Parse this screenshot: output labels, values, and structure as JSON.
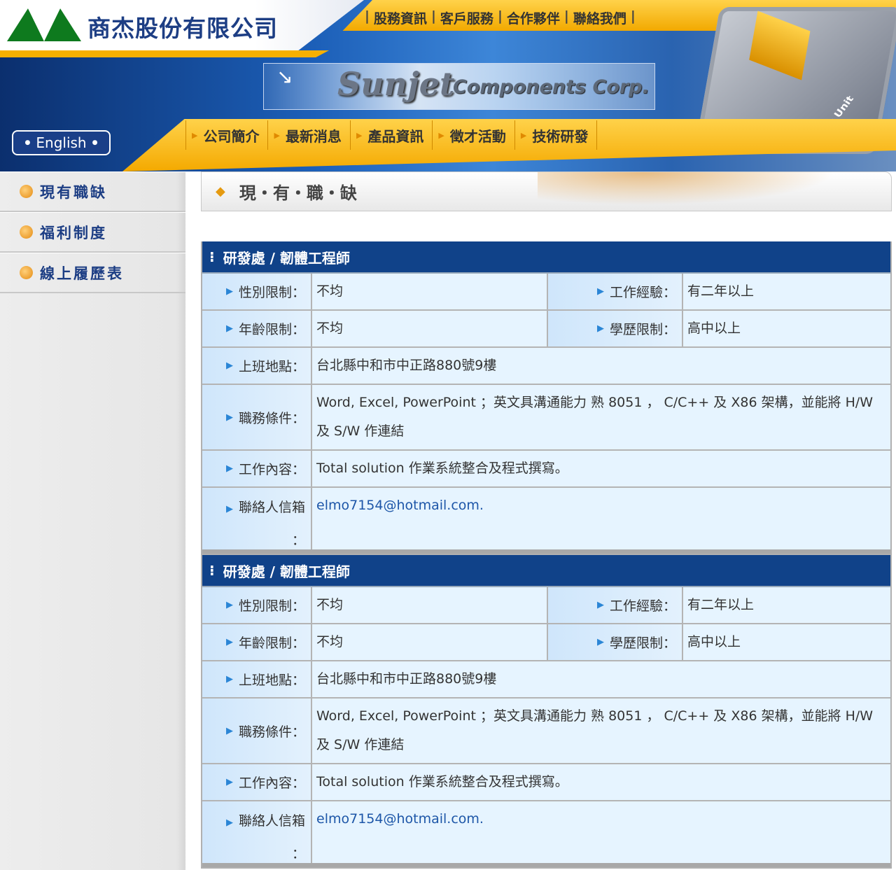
{
  "header": {
    "company_name": "商杰股份有限公司",
    "logo_text": "Sunjet Components Corp.",
    "logo_word1": "Sunjet",
    "logo_word2": "Components Corp.",
    "top_nav": [
      "股務資訊",
      "客戶服務",
      "合作夥伴",
      "聯絡我們"
    ],
    "main_nav": [
      "公司簡介",
      "最新消息",
      "產品資訊",
      "徵才活動",
      "技術研發"
    ],
    "english_button": "English",
    "chip_text": "Body Unit",
    "brand_colors": {
      "navy": "#104289",
      "gold": "#f4a900",
      "green": "#0e7a1e"
    }
  },
  "sidebar": {
    "items": [
      {
        "label": "現有職缺"
      },
      {
        "label": "福利制度"
      },
      {
        "label": "線上履歷表"
      }
    ]
  },
  "page_title": "現・有・職・缺",
  "jobs": [
    {
      "title": "研發處 / 韌體工程師",
      "gender_label": "性別限制：",
      "gender": "不均",
      "experience_label": "工作經驗：",
      "experience": "有二年以上",
      "age_label": "年齡限制：",
      "age": "不均",
      "education_label": "學歷限制：",
      "education": "高中以上",
      "location_label": "上班地點：",
      "location": "台北縣中和市中正路880號9樓",
      "requirements_label": "職務條件：",
      "requirements": "Word, Excel, PowerPoint ；英文具溝通能力 熟 8051 ， C/C++ 及 X86 架構，並能將 H/W 及 S/W 作連結",
      "content_label": "工作內容：",
      "content": "Total solution 作業系統整合及程式撰寫。",
      "email_label": "聯絡人信箱",
      "email_colon": "：",
      "email": "elmo7154@hotmail.com."
    },
    {
      "title": "研發處 / 韌體工程師",
      "gender_label": "性別限制：",
      "gender": "不均",
      "experience_label": "工作經驗：",
      "experience": "有二年以上",
      "age_label": "年齡限制：",
      "age": "不均",
      "education_label": "學歷限制：",
      "education": "高中以上",
      "location_label": "上班地點：",
      "location": "台北縣中和市中正路880號9樓",
      "requirements_label": "職務條件：",
      "requirements": "Word, Excel, PowerPoint ；英文具溝通能力 熟 8051 ， C/C++ 及 X86 架構，並能將 H/W 及 S/W 作連結",
      "content_label": "工作內容：",
      "content": "Total solution 作業系統整合及程式撰寫。",
      "email_label": "聯絡人信箱",
      "email_colon": "：",
      "email": "elmo7154@hotmail.com."
    }
  ]
}
